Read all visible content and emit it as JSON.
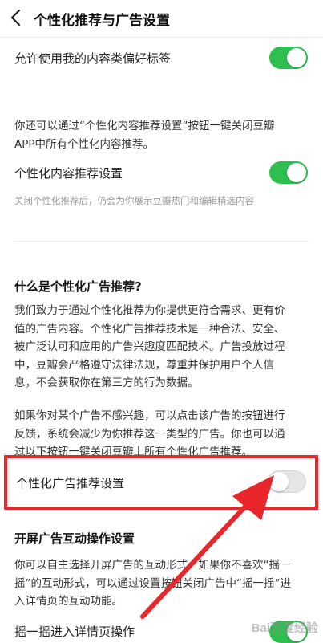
{
  "header": {
    "title": "个性化推荐与广告设置"
  },
  "content_tag": {
    "label": "允许使用我的内容类偏好标签",
    "enabled": true
  },
  "personalized_content": {
    "description_line1": "你还可以通过“个性化内容推荐设置”按钮一键关闭豆瓣",
    "description_line2": "APP中所有个性化内容推荐。",
    "label": "个性化内容推荐设置",
    "enabled": true,
    "hint": "关闭个性化推荐后，仍会为你展示豆瓣热门和编辑精选内容"
  },
  "ad_section": {
    "title": "什么是个性化广告推荐?",
    "para1": [
      "我们致力于通过个性化推荐为你提供更符合需求、更有价",
      "值的广告内容。个性化广告推荐技术是一种合法、安全、",
      "被广泛认可和应用的广告兴趣度匹配技术。广告投放过程",
      "中，豆瓣会严格遵守法律法规，尊重并保护用户个人信",
      "息，不会获取你在第三方的行为数据。"
    ],
    "para2": [
      "如果你对某个广告不感兴趣，可以点击该广告的按钮进行",
      "反馈，系统会减少为你推荐这一类型的广告。你也可以通",
      "过以下按钮一键关闭豆瓣上所有个性化广告推荐。"
    ],
    "toggle_label": "个性化广告推荐设置",
    "enabled": false
  },
  "splash_section": {
    "title": "开屏广告互动操作设置",
    "para": [
      "你可以自主选择开屏广告的互动形式，如果你不喜欢“摇一",
      "摇”的互动形式，可以通过设置按钮关闭广告中“摇一摇”进",
      "入详情页的互动功能。"
    ],
    "toggle_label": "摇一摇进入详情页操作",
    "enabled": true
  },
  "colors": {
    "toggle_on": "#2fbf4f",
    "annotation_red": "#e8262b"
  },
  "watermark": {
    "text": "Bai百度经验",
    "sub": "jingyan.baidu.com"
  }
}
